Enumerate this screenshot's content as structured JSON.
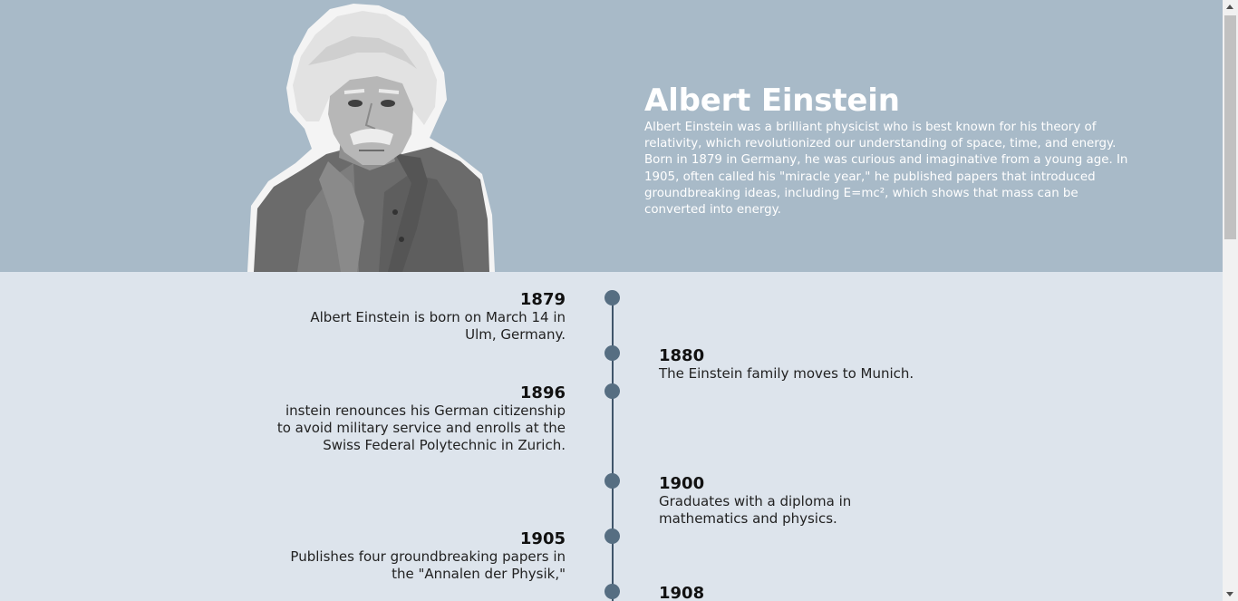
{
  "hero": {
    "name": "Albert Einstein",
    "description": "Albert Einstein was a brilliant physicist who is best known for his theory of relativity, which revolutionized our understanding of space, time, and energy. Born in 1879 in Germany, he was curious and imaginative from a young age. In 1905, often called his \"miracle year,\" he published papers that introduced groundbreaking ideas, including E=mc², which shows that mass can be converted into energy.",
    "colors": {
      "background": "#a8bac8",
      "text": "#ffffff"
    }
  },
  "timeline": {
    "colors": {
      "background": "#dde4ec",
      "axis": "#3f556a",
      "dot": "#566e82"
    },
    "events": [
      {
        "year": "1879",
        "text": "Albert Einstein is born on March 14 in Ulm, Germany.",
        "side": "left"
      },
      {
        "year": "1880",
        "text": "The Einstein family moves to Munich.",
        "side": "right"
      },
      {
        "year": "1896",
        "text": "instein renounces his German citizenship to avoid military service and enrolls at the Swiss Federal Polytechnic in Zurich.",
        "side": "left"
      },
      {
        "year": "1900",
        "text": "Graduates with a diploma in mathematics and physics.",
        "side": "right"
      },
      {
        "year": "1905",
        "text": "Publishes four groundbreaking papers in the \"Annalen der Physik,\"",
        "side": "left"
      },
      {
        "year": "1908",
        "text": "",
        "side": "right"
      }
    ]
  }
}
